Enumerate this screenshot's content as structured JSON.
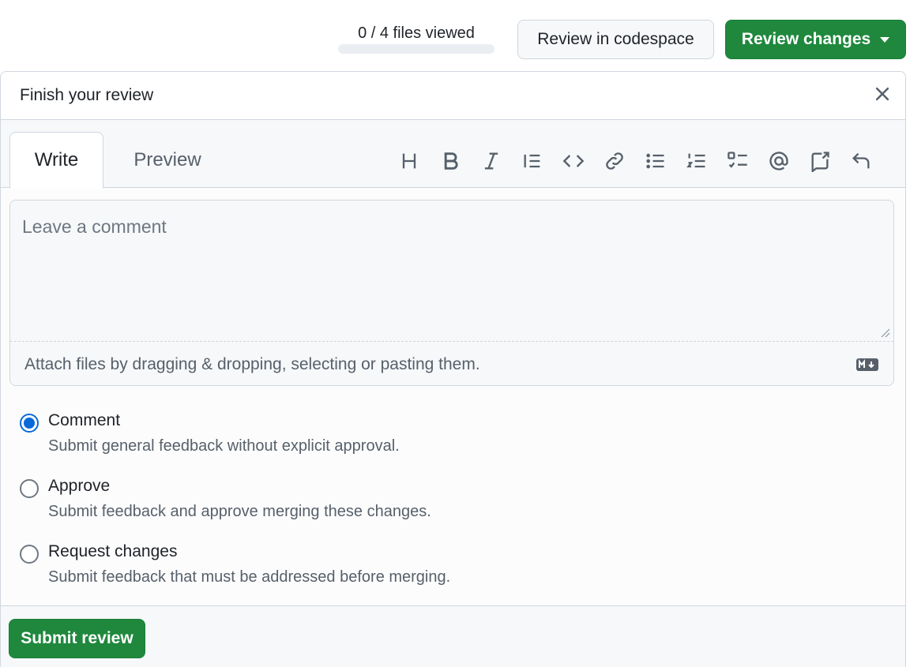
{
  "header": {
    "files_viewed": "0 / 4 files viewed",
    "files_viewed_progress": 0,
    "codespace_button": "Review in codespace",
    "review_changes_button": "Review changes"
  },
  "panel": {
    "title": "Finish your review",
    "close_icon": "close-icon",
    "tabs": [
      {
        "label": "Write",
        "selected": true
      },
      {
        "label": "Preview",
        "selected": false
      }
    ],
    "toolbar_icons": [
      "heading-icon",
      "bold-icon",
      "italic-icon",
      "quote-icon",
      "code-icon",
      "link-icon",
      "unordered-list-icon",
      "ordered-list-icon",
      "task-list-icon",
      "mention-icon",
      "cross-reference-icon",
      "undo-icon"
    ],
    "comment_placeholder": "Leave a comment",
    "attach_text": "Attach files by dragging & dropping, selecting or pasting them.",
    "markdown_icon": "markdown-icon",
    "options": [
      {
        "label": "Comment",
        "description": "Submit general feedback without explicit approval.",
        "checked": true
      },
      {
        "label": "Approve",
        "description": "Submit feedback and approve merging these changes.",
        "checked": false
      },
      {
        "label": "Request changes",
        "description": "Submit feedback that must be addressed before merging.",
        "checked": false
      }
    ],
    "submit_button": "Submit review"
  },
  "colors": {
    "primary_green": "#1f883d",
    "accent_blue": "#0969da",
    "border": "#d0d7de",
    "muted_text": "#57606a"
  }
}
